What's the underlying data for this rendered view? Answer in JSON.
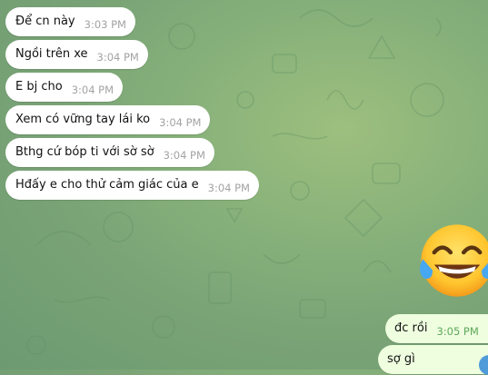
{
  "incoming": [
    {
      "text": "Để cn này",
      "time": "3:03 PM"
    },
    {
      "text": "Ngồi trên xe",
      "time": "3:04 PM"
    },
    {
      "text": "E bj cho",
      "time": "3:04 PM"
    },
    {
      "text": "Xem có vững tay lái ko",
      "time": "3:04 PM"
    },
    {
      "text": "Bthg cứ bóp ti với sờ sờ",
      "time": "3:04 PM"
    },
    {
      "text": "Hđấy e cho thử cảm giác của e",
      "time": "3:04 PM"
    }
  ],
  "outgoing": [
    {
      "text": "đc rồi",
      "time": "3:05 PM"
    },
    {
      "text": "sợ gì",
      "time": ""
    }
  ],
  "sticker": {
    "icon": "tears-of-joy-emoji-icon"
  },
  "colors": {
    "incoming_bg": "#ffffff",
    "outgoing_bg": "#eefedf",
    "time_in": "#a3a3a3",
    "time_out": "#5ea85a"
  }
}
